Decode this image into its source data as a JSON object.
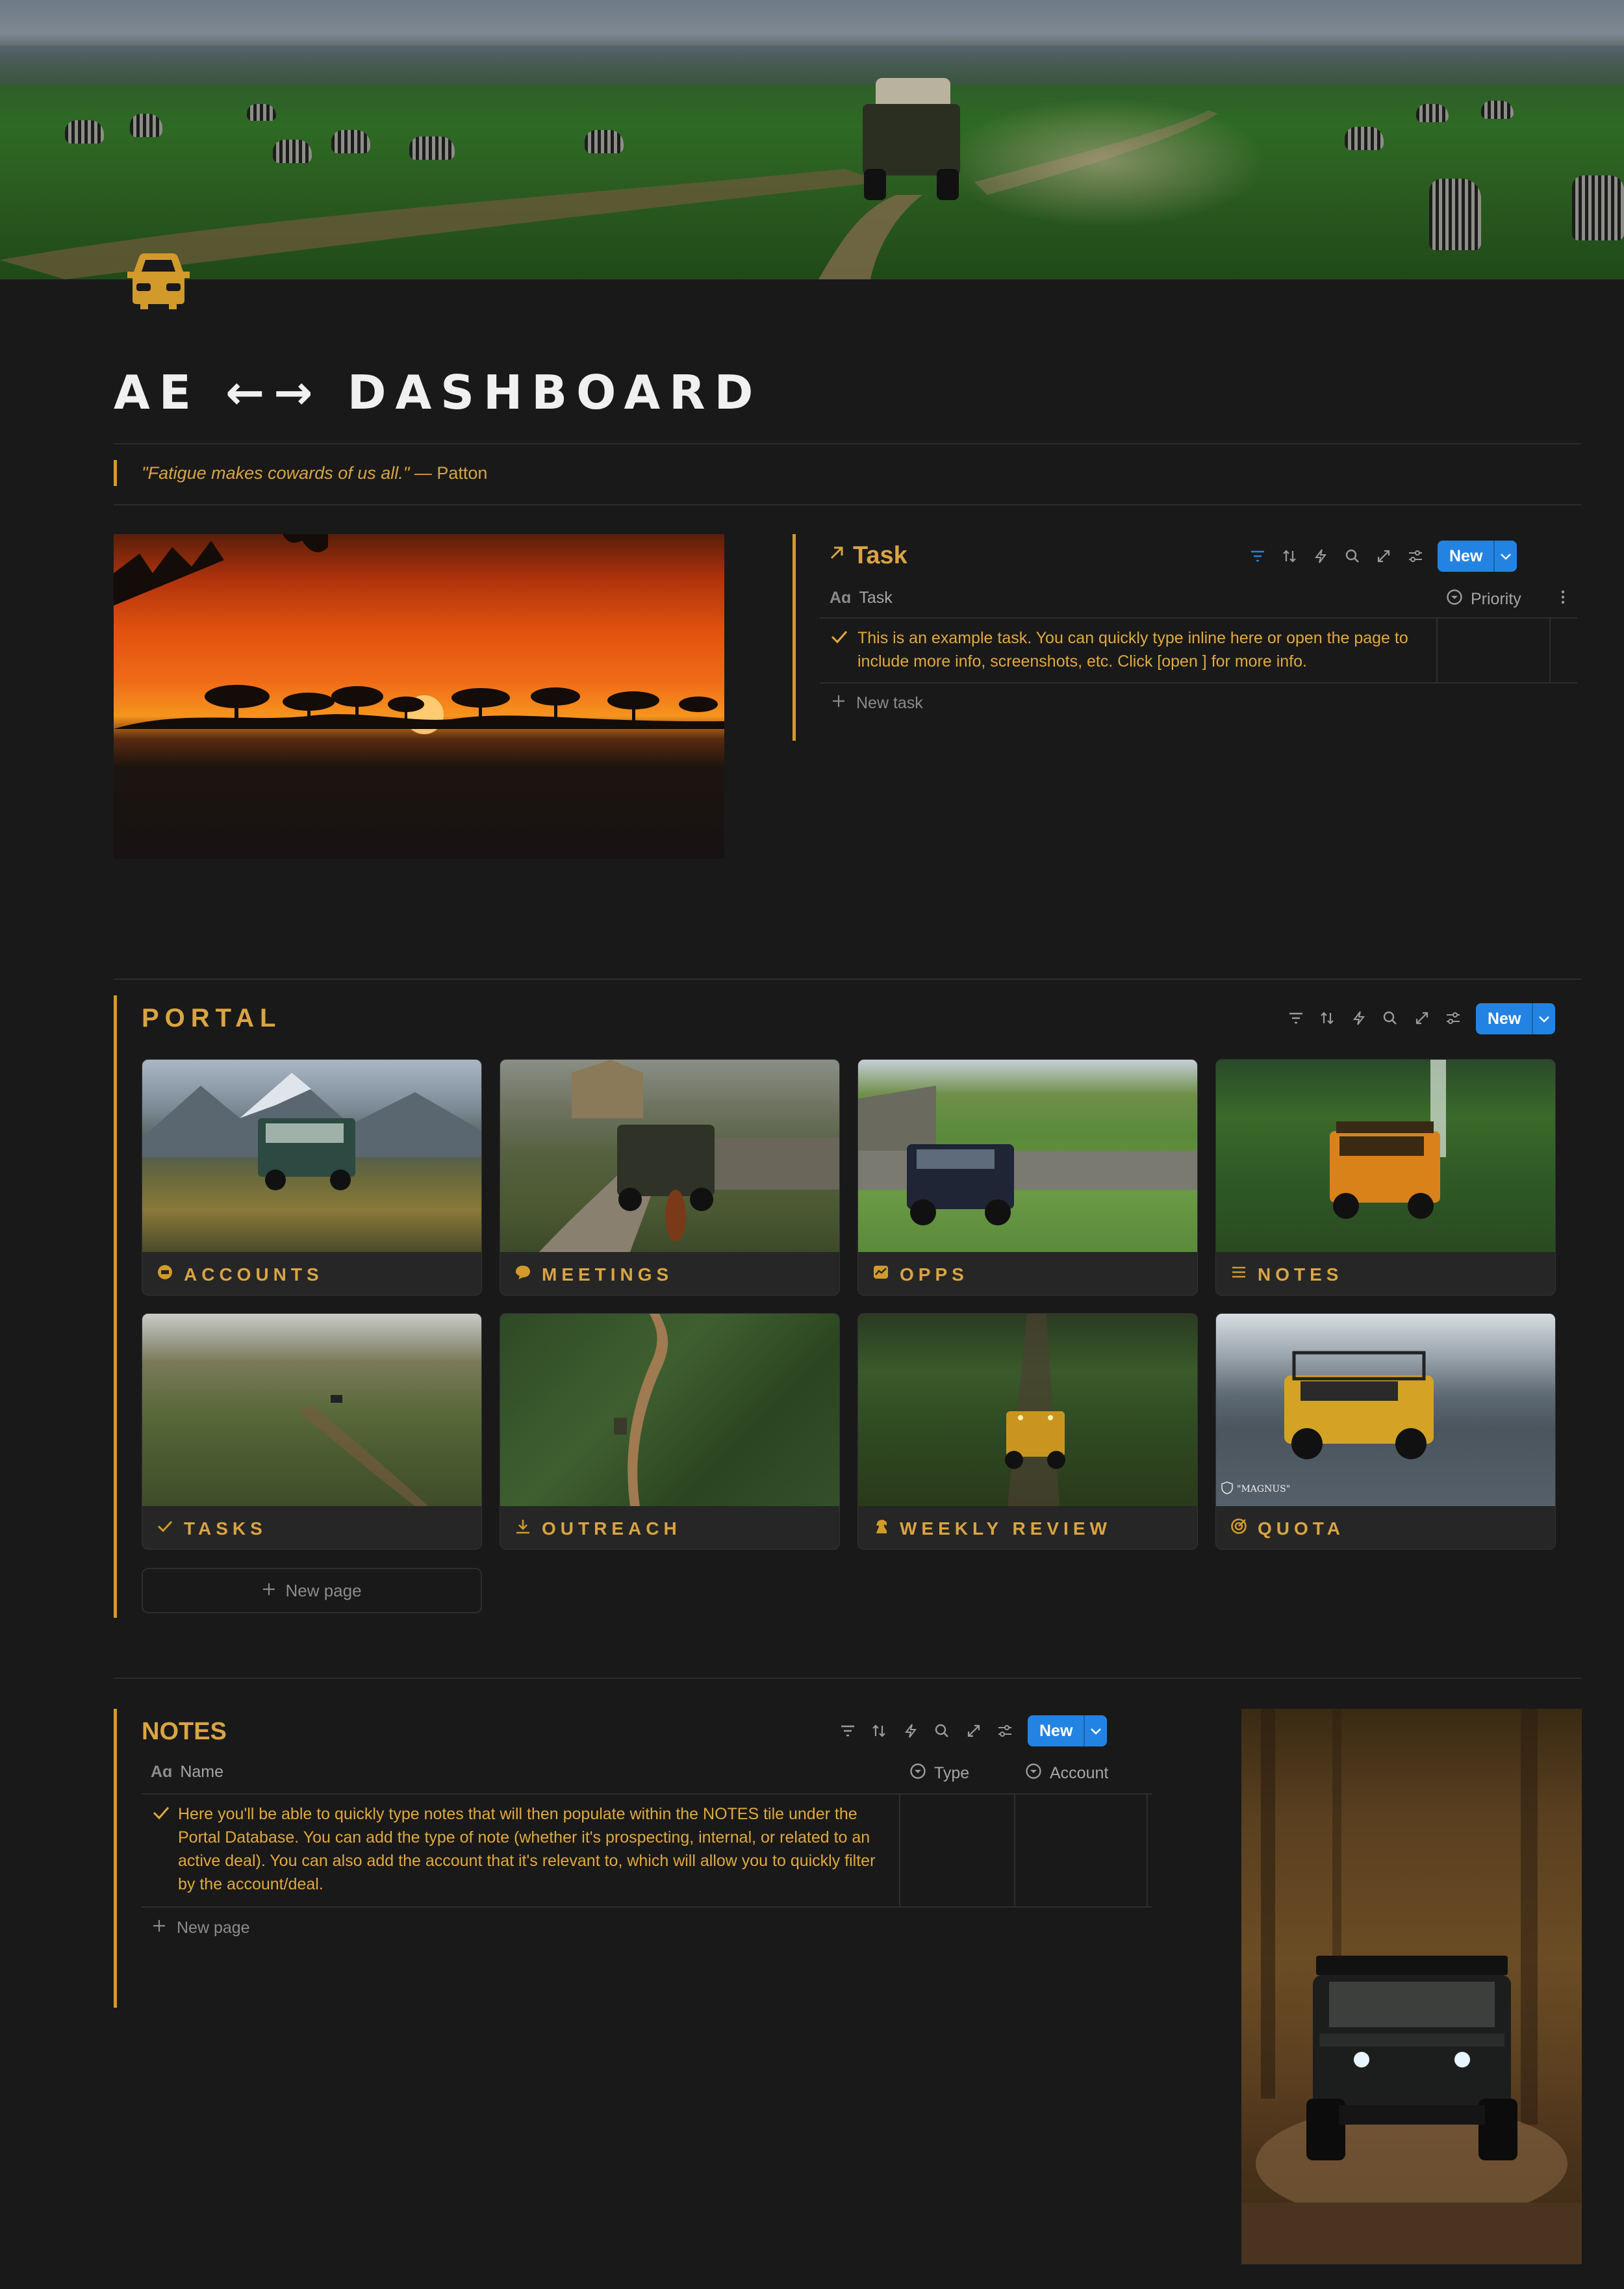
{
  "page": {
    "title": "AE ←→ DASHBOARD",
    "quote_text": "\"Fatigue makes cowards of us all.\"",
    "quote_author": " — Patton"
  },
  "task_db": {
    "title": "Task",
    "new_label": "New",
    "columns": {
      "task": "Task",
      "priority": "Priority"
    },
    "rows": [
      {
        "text": "This is an example task. You can quickly type inline here or open the page to include more info, screenshots, etc. Click [open ] for more info.",
        "priority": ""
      }
    ],
    "new_row_label": "New task"
  },
  "portal": {
    "title": "PORTAL",
    "new_label": "New",
    "cards": [
      {
        "label": "ACCOUNTS",
        "icon": "cash-icon"
      },
      {
        "label": "MEETINGS",
        "icon": "speech-bubble-icon"
      },
      {
        "label": "OPPS",
        "icon": "chart-icon"
      },
      {
        "label": "NOTES",
        "icon": "list-icon"
      },
      {
        "label": "TASKS",
        "icon": "checkmark-icon"
      },
      {
        "label": "OUTREACH",
        "icon": "download-icon"
      },
      {
        "label": "WEEKLY REVIEW",
        "icon": "chess-knight-icon"
      },
      {
        "label": "QUOTA",
        "icon": "target-icon"
      }
    ],
    "quota_watermark": "\"MAGNUS\"",
    "new_page_label": "New page"
  },
  "notes_db": {
    "title": "NOTES",
    "new_label": "New",
    "columns": {
      "name": "Name",
      "type": "Type",
      "account": "Account"
    },
    "rows": [
      {
        "text": "Here you'll be able to quickly type notes that will then populate within the NOTES tile under the Portal Database. You can add the type of note (whether it's prospecting, internal, or related to an active deal). You can also add the account that it's relevant to, which will allow you to quickly filter by the account/deal.",
        "type": "",
        "account": ""
      }
    ],
    "new_row_label": "New page"
  },
  "colors": {
    "accent": "#d19a2b",
    "accent_text": "#d9a443",
    "button_blue": "#2383e2",
    "background": "#191919"
  }
}
